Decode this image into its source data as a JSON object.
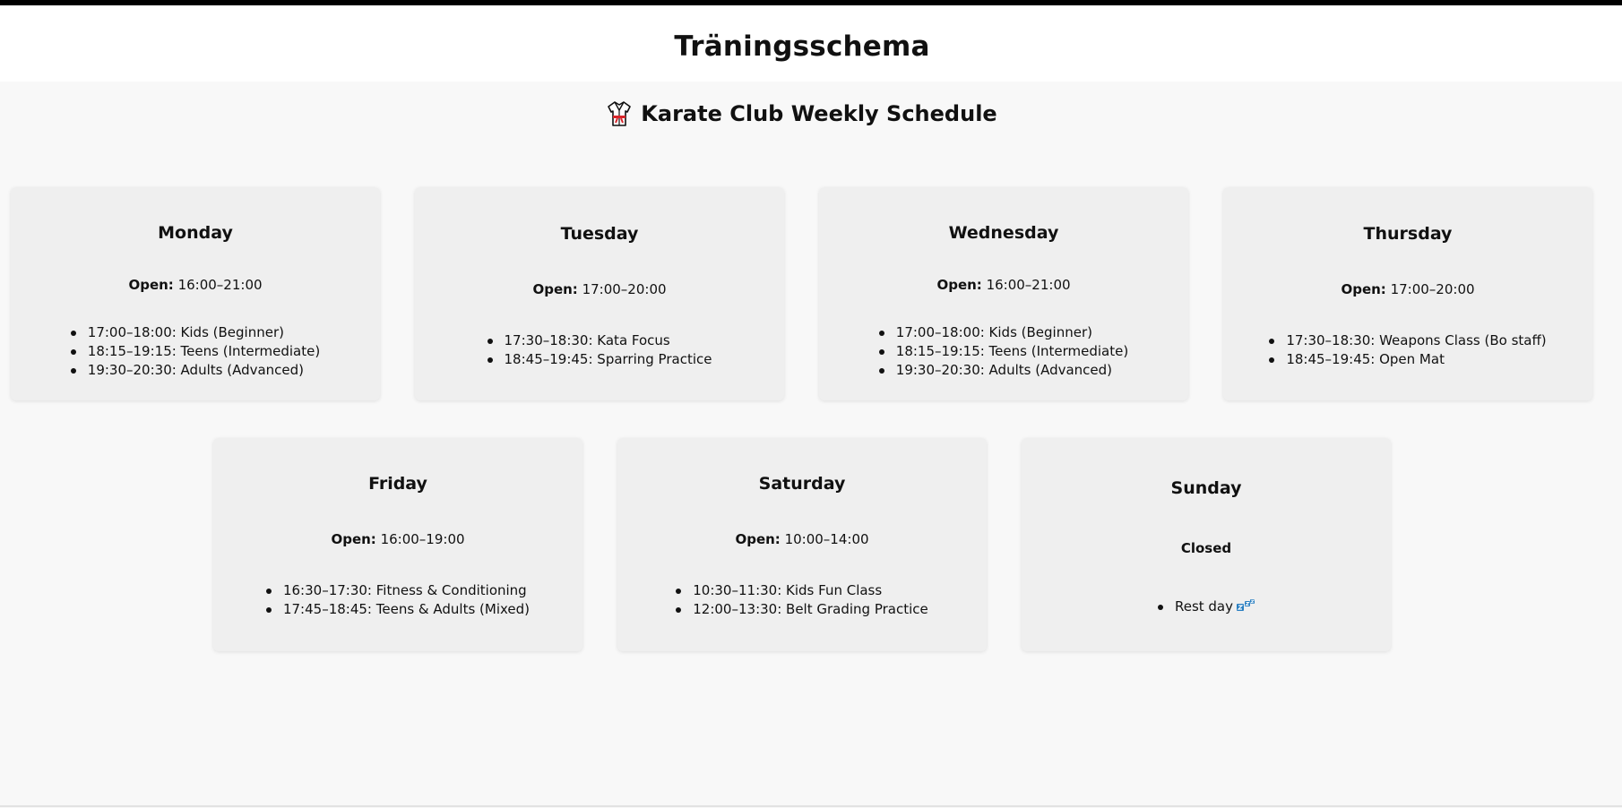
{
  "header": {
    "title": "Träningsschema",
    "subtitle": "Karate Club Weekly Schedule",
    "subtitle_icon": "karate-gi-icon"
  },
  "open_label": "Open:",
  "days": [
    {
      "name": "Monday",
      "hours": "16:00–21:00",
      "classes": [
        "17:00–18:00: Kids (Beginner)",
        "18:15–19:15: Teens (Intermediate)",
        "19:30–20:30: Adults (Advanced)"
      ]
    },
    {
      "name": "Tuesday",
      "hours": "17:00–20:00",
      "classes": [
        "17:30–18:30: Kata Focus",
        "18:45–19:45: Sparring Practice"
      ]
    },
    {
      "name": "Wednesday",
      "hours": "16:00–21:00",
      "classes": [
        "17:00–18:00: Kids (Beginner)",
        "18:15–19:15: Teens (Intermediate)",
        "19:30–20:30: Adults (Advanced)"
      ]
    },
    {
      "name": "Thursday",
      "hours": "17:00–20:00",
      "classes": [
        "17:30–18:30: Weapons Class (Bo staff)",
        "18:45–19:45: Open Mat"
      ]
    },
    {
      "name": "Friday",
      "hours": "16:00–19:00",
      "classes": [
        "16:30–17:30: Fitness & Conditioning",
        "17:45–18:45: Teens & Adults (Mixed)"
      ]
    },
    {
      "name": "Saturday",
      "hours": "10:00–14:00",
      "classes": [
        "10:30–11:30: Kids Fun Class",
        "12:00–13:30: Belt Grading Practice"
      ]
    },
    {
      "name": "Sunday",
      "status": "Closed",
      "classes": [
        "Rest day"
      ],
      "rest_icon": "sleeping-zzz-icon"
    }
  ]
}
